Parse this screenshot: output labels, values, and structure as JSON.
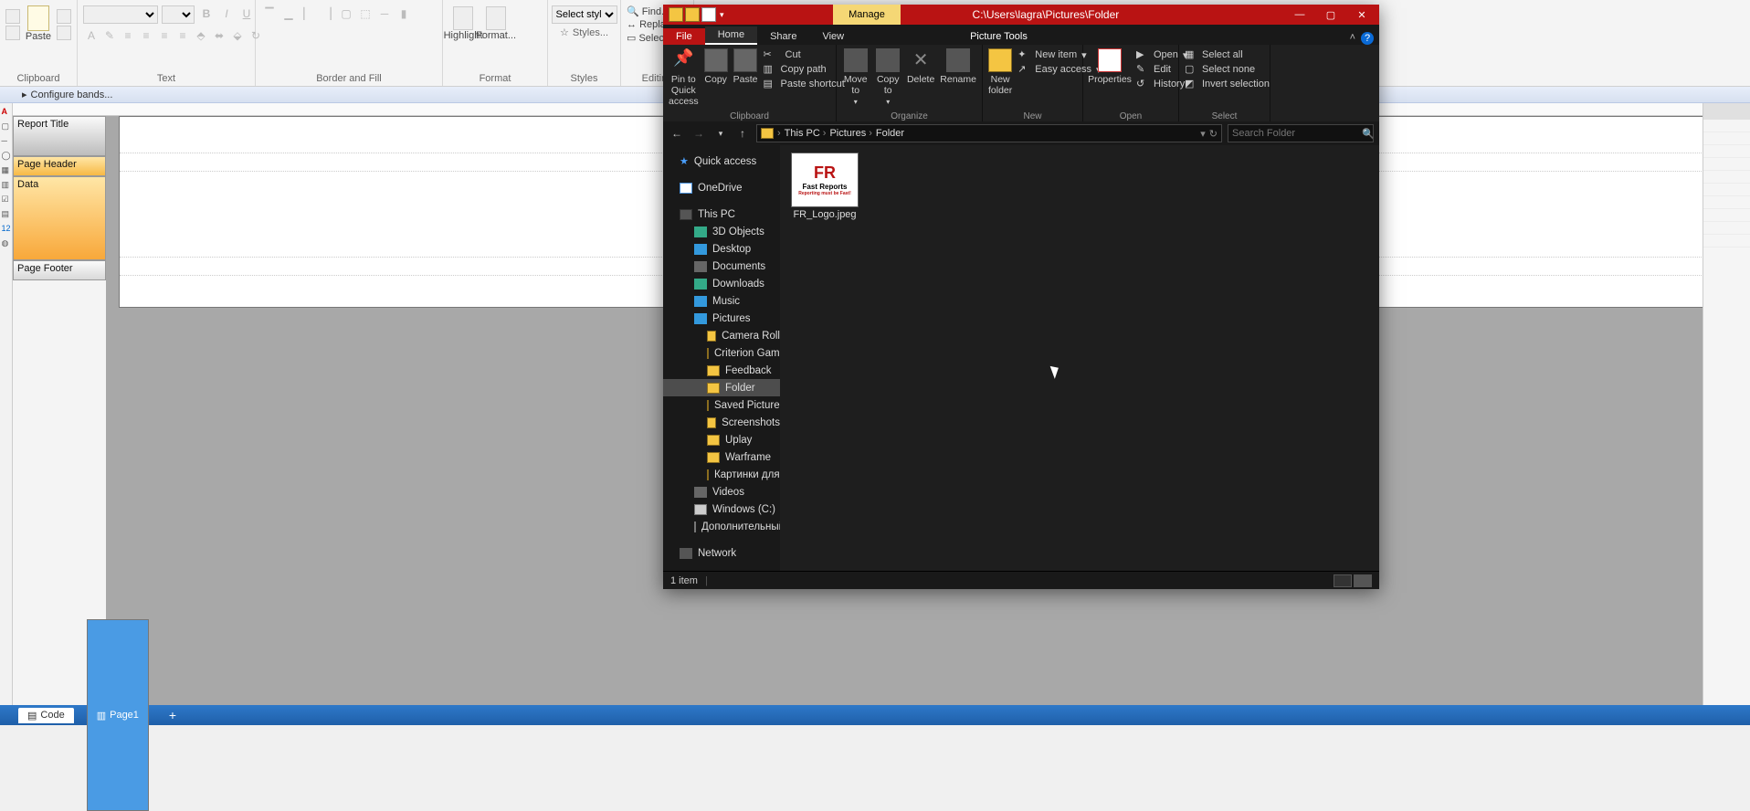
{
  "bg": {
    "configure": "Configure bands...",
    "ribbon_groups": {
      "clipboard": "Clipboard",
      "paste": "Paste",
      "text": "Text",
      "border": "Border and Fill",
      "format": "Format",
      "highlight": "Highlight",
      "format_btn": "Format...",
      "styles": "Styles",
      "styles_btn": "Styles...",
      "select_style": "Select style",
      "editing": "Editing",
      "find": "Find...",
      "replace": "Replace...",
      "select_all": "Select All"
    },
    "bands": {
      "title": "Report Title",
      "header": "Page Header",
      "data": "Data",
      "footer": "Page Footer"
    },
    "tabs": {
      "code": "Code",
      "page": "Page1"
    }
  },
  "explorer": {
    "title_path": "C:\\Users\\lagra\\Pictures\\Folder",
    "manage": "Manage",
    "tabs": {
      "file": "File",
      "home": "Home",
      "share": "Share",
      "view": "View",
      "ptools": "Picture Tools"
    },
    "ribbon": {
      "pin": "Pin to Quick access",
      "copy": "Copy",
      "paste": "Paste",
      "cut": "Cut",
      "copy_path": "Copy path",
      "paste_shortcut": "Paste shortcut",
      "clipboard": "Clipboard",
      "moveto": "Move to",
      "copyto": "Copy to",
      "delete": "Delete",
      "rename": "Rename",
      "organize": "Organize",
      "newfolder": "New folder",
      "newitem": "New item",
      "easyaccess": "Easy access",
      "new": "New",
      "properties": "Properties",
      "open": "Open",
      "edit": "Edit",
      "history": "History",
      "open_grp": "Open",
      "selectall": "Select all",
      "selectnone": "Select none",
      "invert": "Invert selection",
      "select": "Select"
    },
    "breadcrumbs": [
      "This PC",
      "Pictures",
      "Folder"
    ],
    "search_placeholder": "Search Folder",
    "nav": {
      "quick": "Quick access",
      "onedrive": "OneDrive",
      "thispc": "This PC",
      "threed": "3D Objects",
      "desktop": "Desktop",
      "documents": "Documents",
      "downloads": "Downloads",
      "music": "Music",
      "pictures": "Pictures",
      "camera": "Camera Roll",
      "criterion": "Criterion Games",
      "feedback": "Feedback",
      "folder": "Folder",
      "saved": "Saved Pictures",
      "screenshots": "Screenshots",
      "uplay": "Uplay",
      "warframe": "Warframe",
      "kartinki": "Картинки для блс",
      "videos": "Videos",
      "windowsc": "Windows (C:)",
      "dopol": "Дополнительный (",
      "network": "Network"
    },
    "file": {
      "name": "FR_Logo.jpeg",
      "brand": "Fast Reports",
      "tagline": "Reporting must be Fast!"
    },
    "status": "1 item"
  }
}
